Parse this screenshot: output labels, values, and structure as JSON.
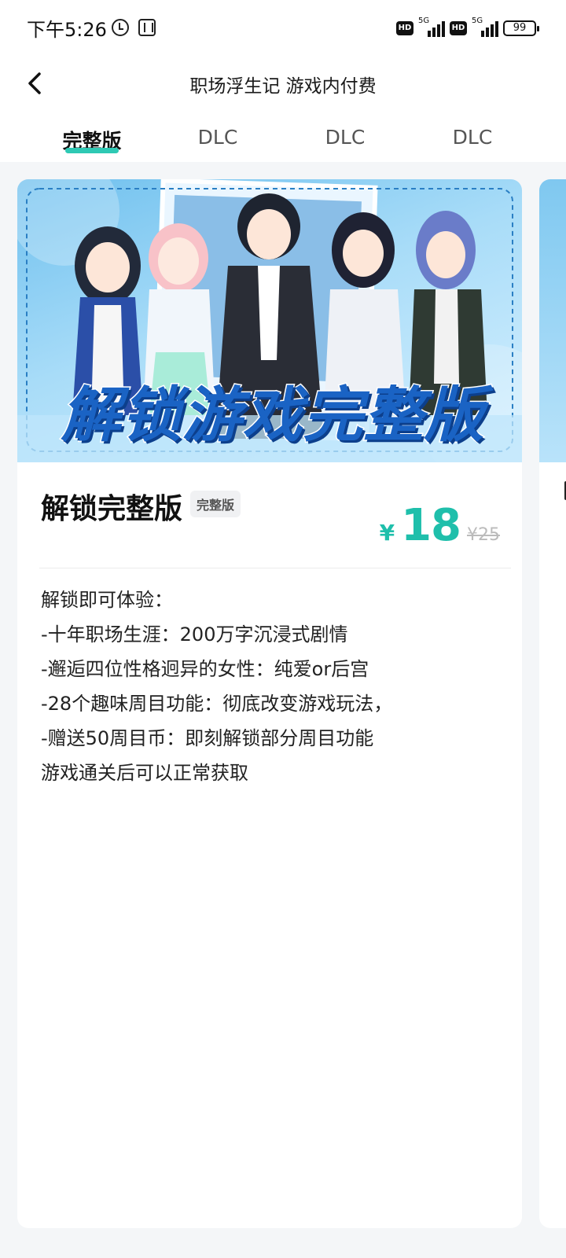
{
  "status_bar": {
    "time": "下午5:26",
    "network_1": "5G",
    "network_2": "5G",
    "hd_1": "HD",
    "hd_2": "HD",
    "battery": "99"
  },
  "nav": {
    "title": "职场浮生记 游戏内付费"
  },
  "tabs": [
    {
      "label": "完整版",
      "active": true
    },
    {
      "label": "DLC",
      "active": false
    },
    {
      "label": "DLC",
      "active": false
    },
    {
      "label": "DLC",
      "active": false
    }
  ],
  "product": {
    "banner_text": "解锁游戏完整版",
    "title": "解锁完整版",
    "badge": "完整版",
    "currency": "¥",
    "price": "18",
    "original_price": "¥25",
    "description": [
      "解锁即可体验：",
      "-十年职场生涯：200万字沉浸式剧情",
      "-邂逅四位性格迥异的女性：纯爱or后宫",
      "-28个趣味周目功能：彻底改变游戏玩法，",
      "-赠送50周目币：即刻解锁部分周目功能",
      "游戏通关后可以正常获取"
    ]
  },
  "colors": {
    "accent": "#2ec9b4",
    "price": "#1fbfab"
  },
  "icons": {
    "back": "chevron-left-icon",
    "alarm": "alarm-icon",
    "nfc": "nfc-icon"
  }
}
